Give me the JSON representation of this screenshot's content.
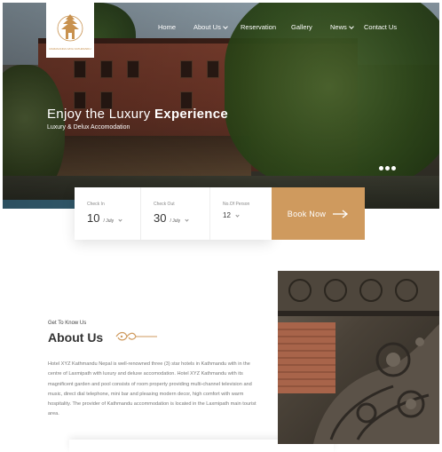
{
  "brand": {
    "logo_text": "RAMANANDA NAYA KATHMANDU"
  },
  "nav": {
    "items": [
      {
        "label": "Home",
        "dropdown": false
      },
      {
        "label": "About Us",
        "dropdown": true
      },
      {
        "label": "Reservation",
        "dropdown": false
      },
      {
        "label": "Gallery",
        "dropdown": false
      },
      {
        "label": "News",
        "dropdown": true
      },
      {
        "label": "Contact Us",
        "dropdown": false
      }
    ]
  },
  "hero": {
    "title_prefix": "Enjoy the Luxury",
    "title_emphasis": "Experience",
    "subtitle": "Luxury & Delux Accomodation",
    "slides_total": 3,
    "active_slide": 1
  },
  "booking": {
    "check_in": {
      "label": "Check In",
      "day": "10",
      "month": "/ July"
    },
    "check_out": {
      "label": "Check Out",
      "day": "30",
      "month": "/ July"
    },
    "persons": {
      "label": "No.Of Person",
      "value": "12"
    },
    "button_label": "Book Now"
  },
  "about": {
    "eyebrow": "Get To Know Us",
    "title": "About Us",
    "body": "Hotel XYZ Kathmandu Nepal is well-renowned three (3) star hotels in Kathmandu with in the centre of Laxmipath with luxury and deluxe accomodation. Hotel XYZ Kathmandu with its magnificent garden and pool consists of room property providing multi-channel television and music, direct dial telephone, mini bar and pleasing modern decor, high comfort with warm hospitality. The provider of Kathmandu accommodation is located in the Laxmipath main tourist area."
  },
  "colors": {
    "accent": "#cf9a5e",
    "text_dark": "#333333",
    "text_muted": "#777777"
  }
}
